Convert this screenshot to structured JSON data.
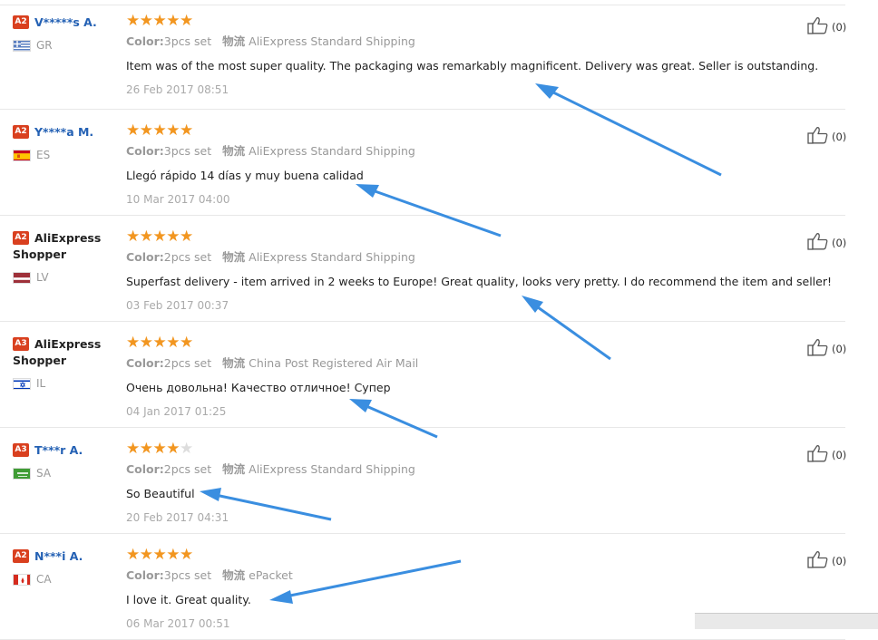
{
  "reviews": [
    {
      "level": "A2",
      "name": "V*****s A.",
      "shopper": false,
      "country": "GR",
      "stars": 5,
      "color_label": "Color:",
      "color_value": "3pcs set",
      "ship_chars": "物流",
      "shipping": "AliExpress Standard Shipping",
      "text": "Item was of the most super quality. The packaging was remarkably magnificent. Delivery was great. Seller is outstanding.",
      "date": "26 Feb 2017 08:51",
      "helpful": "(0)"
    },
    {
      "level": "A2",
      "name": "Y****a M.",
      "shopper": false,
      "country": "ES",
      "stars": 5,
      "color_label": "Color:",
      "color_value": "3pcs set",
      "ship_chars": "物流",
      "shipping": "AliExpress Standard Shipping",
      "text": "Llegó rápido 14 días y muy buena calidad",
      "date": "10 Mar 2017 04:00",
      "helpful": "(0)"
    },
    {
      "level": "A2",
      "name": "AliExpress Shopper",
      "shopper": true,
      "country": "LV",
      "stars": 5,
      "color_label": "Color:",
      "color_value": "2pcs set",
      "ship_chars": "物流",
      "shipping": "AliExpress Standard Shipping",
      "text": "Superfast delivery - item arrived in 2 weeks to Europe! Great quality, looks very pretty. I do recommend the item and seller!",
      "date": "03 Feb 2017 00:37",
      "helpful": "(0)"
    },
    {
      "level": "A3",
      "name": "AliExpress Shopper",
      "shopper": true,
      "country": "IL",
      "stars": 5,
      "color_label": "Color:",
      "color_value": "2pcs set",
      "ship_chars": "物流",
      "shipping": "China Post Registered Air Mail",
      "text": "Очень довольна! Качество отличное! Супер",
      "date": "04 Jan 2017 01:25",
      "helpful": "(0)"
    },
    {
      "level": "A3",
      "name": "T***r A.",
      "shopper": false,
      "country": "SA",
      "stars": 4,
      "color_label": "Color:",
      "color_value": "2pcs set",
      "ship_chars": "物流",
      "shipping": "AliExpress Standard Shipping",
      "text": "So Beautiful",
      "date": "20 Feb 2017 04:31",
      "helpful": "(0)"
    },
    {
      "level": "A2",
      "name": "N***i A.",
      "shopper": false,
      "country": "CA",
      "stars": 5,
      "color_label": "Color:",
      "color_value": "3pcs set",
      "ship_chars": "物流",
      "shipping": "ePacket",
      "text": "I love it. Great quality.",
      "date": "06 Mar 2017 00:51",
      "helpful": "(0)"
    }
  ],
  "colors": {
    "accent": "#2461b4",
    "level_badge": "#d9401f",
    "star": "#f29620",
    "arrow": "#3a8ee0"
  }
}
